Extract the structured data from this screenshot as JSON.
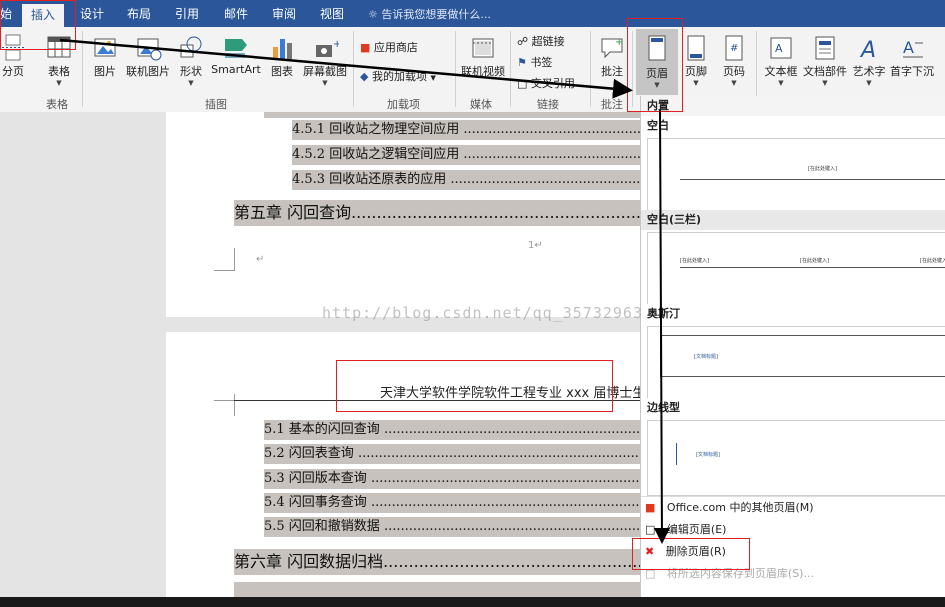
{
  "tabs": [
    "始",
    "插入",
    "设计",
    "布局",
    "引用",
    "邮件",
    "审阅",
    "视图"
  ],
  "tell_me": "告诉我您想要做什么...",
  "ribbon": {
    "page_break": "分页",
    "table": "表格",
    "picture": "图片",
    "online_picture": "联机图片",
    "shapes": "形状",
    "smartart": "SmartArt",
    "chart": "图表",
    "screenshot": "屏幕截图",
    "store": "应用商店",
    "my_addins": "我的加载项",
    "online_video": "联机视频",
    "hyperlink": "超链接",
    "bookmark": "书签",
    "cross_ref": "交叉引用",
    "comment": "批注",
    "header": "页眉",
    "footer": "页脚",
    "page_number": "页码",
    "textbox": "文本框",
    "quick_parts": "文档部件",
    "wordart": "艺术字",
    "dropcap": "首字下沉",
    "groups": {
      "table": "表格",
      "illustrations": "插图",
      "addins": "加载项",
      "media": "媒体",
      "links": "链接",
      "comments": "批注"
    }
  },
  "doc": {
    "toc": [
      "4.5.1  回收站之物理空间应用 ........................................................................................................",
      "4.5.2  回收站之逻辑空间应用 ........................................................................................................",
      "4.5.3  回收站还原表的应用 ............................................................................................................"
    ],
    "chapter5": "第五章    闪回查询......................................................................................................",
    "page_number": "1↵",
    "para_mark": "↵",
    "header_text": "天津大学软件学院软件工程专业 xxx 届博士生毕",
    "toc2": [
      "5.1 基本的闪回查询 ....................................................................................................................",
      "5.2 闪回表查询 .............................................................................................................................",
      "5.3 闪回版本查询 .........................................................................................................................",
      "5.4 闪回事务查询 .........................................................................................................................",
      "5.5 闪回和撤销数据 ....................................................................................................................."
    ],
    "chapter6": "第六章    闪回数据归档......................................................................................................",
    "watermark": "http://blog.csdn.net/qq_35732963"
  },
  "dropdown": {
    "builtin": "内置",
    "blank": "空白",
    "blank_three": "空白(三栏)",
    "austin": "奥斯汀",
    "sideline": "边线型",
    "placeholder": "[在此处键入]",
    "doc_title": "[文档标题]",
    "more_office": "Office.com 中的其他页眉(M)",
    "edit_header": "编辑页眉(E)",
    "remove_header": "删除页眉(R)",
    "save_selection": "将所选内容保存到页眉库(S)..."
  },
  "colors": {
    "accent": "#2b579a",
    "annotation": "#e02020",
    "highlight": "#c7c2bd"
  }
}
